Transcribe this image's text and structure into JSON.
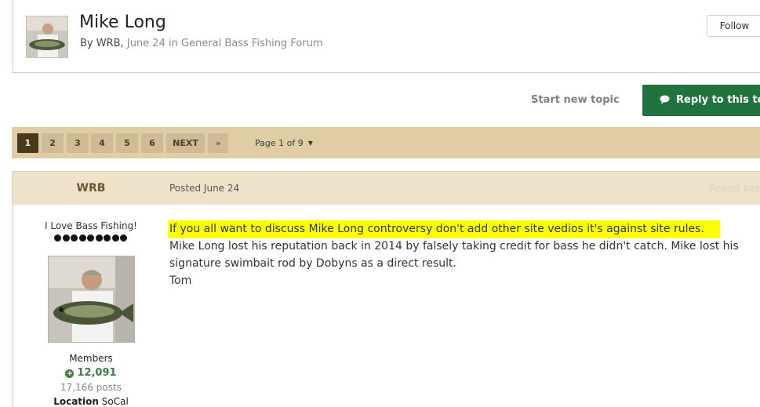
{
  "topic": {
    "title": "Mike Long",
    "by_label": "By",
    "author": "WRB",
    "date": "June 24",
    "in_label": "in",
    "forum": "General Bass Fishing Forum",
    "follow_label": "Follow"
  },
  "actions": {
    "start_topic_label": "Start new topic",
    "reply_label": "Reply to this to"
  },
  "pagination": {
    "pages": [
      "1",
      "2",
      "3",
      "4",
      "5",
      "6"
    ],
    "current_page": "1",
    "next_label": "NEXT",
    "last_label": "»",
    "page_jump_label": "Page 1 of 9"
  },
  "post": {
    "author_name": "WRB",
    "posted_label": "Posted June 24",
    "report_label": "Report post",
    "author_title": "I Love Bass Fishing!",
    "rank_pips": 9,
    "group": "Members",
    "reputation": "12,091",
    "post_count": "17,166 posts",
    "location_label": "Location",
    "location_value": "SoCal",
    "body": {
      "highlighted_line": "If you all want to discuss Mike Long controversy don't add other site vedios it's against site rules.",
      "paragraph": "Mike Long lost his reputation back in 2014 by falsely taking credit for bass he didn't catch. Mike lost his signature swimbait rod by Dobyns as a direct result.",
      "signoff": "Tom"
    }
  },
  "colors": {
    "accent_green": "#20733e",
    "pagination_bg": "#e1cda4",
    "post_header_bg": "#eee2c8",
    "highlight": "#ffff00"
  },
  "icons": {
    "reply": "comment-icon",
    "caret": "caret-down-icon",
    "reputation": "plus-circle-icon"
  }
}
